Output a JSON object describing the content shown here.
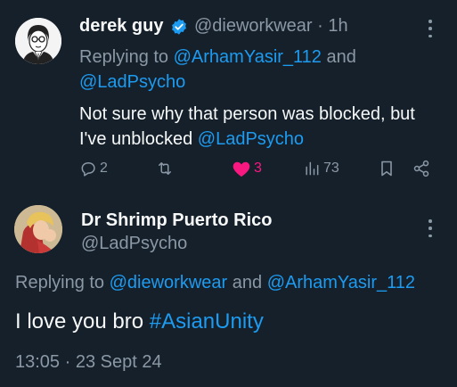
{
  "tweet1": {
    "name": "derek guy",
    "handle_time": "@dieworkwear · 1h",
    "replying_prefix": "Replying to ",
    "replying_mention1": "@ArhamYasir_112",
    "replying_and": " and ",
    "replying_mention2": "@LadPsycho",
    "text_before": "Not sure why that person was blocked, but I've unblocked ",
    "text_mention": "@LadPsycho",
    "replies": "2",
    "likes": "3",
    "views": "73",
    "like_color": "#f91880",
    "verified_color": "#1d9bf0"
  },
  "tweet2": {
    "name": "Dr Shrimp Puerto Rico",
    "handle": "@LadPsycho",
    "replying_prefix": "Replying to ",
    "replying_mention1": "@dieworkwear",
    "replying_and": " and ",
    "replying_mention2": "@ArhamYasir_112",
    "text_before": "I love you bro ",
    "text_hashtag": "#AsianUnity",
    "timestamp": "13:05 · 23 Sept 24"
  },
  "colors": {
    "background": "#15202b",
    "text": "#f7f9f9",
    "muted": "#8b98a5",
    "link": "#1d9bf0"
  },
  "icons": {
    "reply": "reply-icon",
    "retweet": "retweet-icon",
    "like": "heart-filled-icon",
    "views": "views-icon",
    "bookmark": "bookmark-icon",
    "share": "share-icon",
    "more": "more-icon",
    "verified": "verified-badge-icon"
  }
}
